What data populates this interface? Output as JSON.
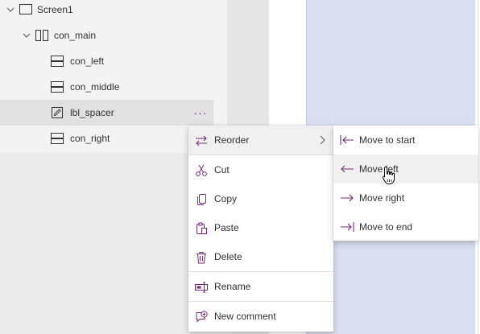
{
  "tree": {
    "items": [
      {
        "label": "Screen1",
        "icon": "screen-icon",
        "expanded": true
      },
      {
        "label": "con_main",
        "icon": "horizontal-container-icon",
        "expanded": true
      },
      {
        "label": "con_left",
        "icon": "vertical-container-icon"
      },
      {
        "label": "con_middle",
        "icon": "vertical-container-icon"
      },
      {
        "label": "lbl_spacer",
        "icon": "label-edit-icon",
        "selected": true
      },
      {
        "label": "con_right",
        "icon": "vertical-container-icon"
      }
    ],
    "more_button": "···"
  },
  "context_menu": {
    "items": [
      {
        "label": "Reorder",
        "icon": "reorder-icon",
        "has_submenu": true
      },
      {
        "label": "Cut",
        "icon": "cut-icon"
      },
      {
        "label": "Copy",
        "icon": "copy-icon"
      },
      {
        "label": "Paste",
        "icon": "paste-icon"
      },
      {
        "label": "Delete",
        "icon": "delete-icon"
      },
      {
        "label": "Rename",
        "icon": "rename-icon"
      },
      {
        "label": "New comment",
        "icon": "comment-add-icon"
      }
    ]
  },
  "reorder_submenu": {
    "items": [
      {
        "label": "Move to start",
        "icon": "move-to-start-icon"
      },
      {
        "label": "Move left",
        "icon": "move-left-icon",
        "hovered": true
      },
      {
        "label": "Move right",
        "icon": "move-right-icon"
      },
      {
        "label": "Move to end",
        "icon": "move-to-end-icon"
      }
    ]
  },
  "colors": {
    "accent": "#742774",
    "canvas_blue": "#d9dff1",
    "panel_bg": "#f3f3f3",
    "selected_row": "#e1e1e1",
    "hover_bg": "#f0f0f0"
  }
}
